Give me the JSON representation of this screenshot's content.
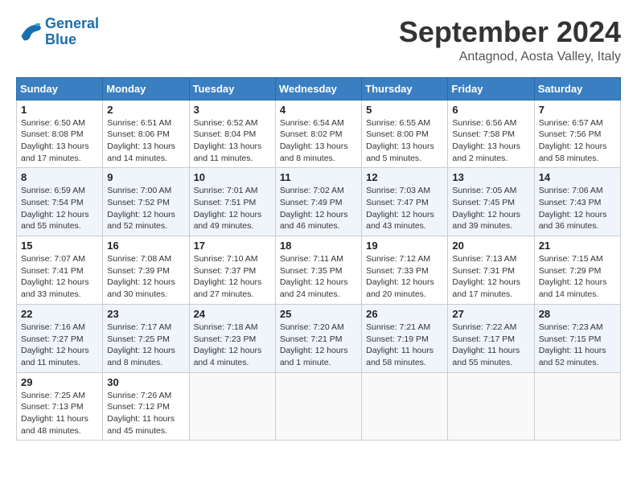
{
  "header": {
    "logo": {
      "line1": "General",
      "line2": "Blue"
    },
    "title": "September 2024",
    "location": "Antagnod, Aosta Valley, Italy"
  },
  "weekdays": [
    "Sunday",
    "Monday",
    "Tuesday",
    "Wednesday",
    "Thursday",
    "Friday",
    "Saturday"
  ],
  "weeks": [
    [
      {
        "day": "1",
        "sunrise": "6:50 AM",
        "sunset": "8:08 PM",
        "daylight": "13 hours and 17 minutes."
      },
      {
        "day": "2",
        "sunrise": "6:51 AM",
        "sunset": "8:06 PM",
        "daylight": "13 hours and 14 minutes."
      },
      {
        "day": "3",
        "sunrise": "6:52 AM",
        "sunset": "8:04 PM",
        "daylight": "13 hours and 11 minutes."
      },
      {
        "day": "4",
        "sunrise": "6:54 AM",
        "sunset": "8:02 PM",
        "daylight": "13 hours and 8 minutes."
      },
      {
        "day": "5",
        "sunrise": "6:55 AM",
        "sunset": "8:00 PM",
        "daylight": "13 hours and 5 minutes."
      },
      {
        "day": "6",
        "sunrise": "6:56 AM",
        "sunset": "7:58 PM",
        "daylight": "13 hours and 2 minutes."
      },
      {
        "day": "7",
        "sunrise": "6:57 AM",
        "sunset": "7:56 PM",
        "daylight": "12 hours and 58 minutes."
      }
    ],
    [
      {
        "day": "8",
        "sunrise": "6:59 AM",
        "sunset": "7:54 PM",
        "daylight": "12 hours and 55 minutes."
      },
      {
        "day": "9",
        "sunrise": "7:00 AM",
        "sunset": "7:52 PM",
        "daylight": "12 hours and 52 minutes."
      },
      {
        "day": "10",
        "sunrise": "7:01 AM",
        "sunset": "7:51 PM",
        "daylight": "12 hours and 49 minutes."
      },
      {
        "day": "11",
        "sunrise": "7:02 AM",
        "sunset": "7:49 PM",
        "daylight": "12 hours and 46 minutes."
      },
      {
        "day": "12",
        "sunrise": "7:03 AM",
        "sunset": "7:47 PM",
        "daylight": "12 hours and 43 minutes."
      },
      {
        "day": "13",
        "sunrise": "7:05 AM",
        "sunset": "7:45 PM",
        "daylight": "12 hours and 39 minutes."
      },
      {
        "day": "14",
        "sunrise": "7:06 AM",
        "sunset": "7:43 PM",
        "daylight": "12 hours and 36 minutes."
      }
    ],
    [
      {
        "day": "15",
        "sunrise": "7:07 AM",
        "sunset": "7:41 PM",
        "daylight": "12 hours and 33 minutes."
      },
      {
        "day": "16",
        "sunrise": "7:08 AM",
        "sunset": "7:39 PM",
        "daylight": "12 hours and 30 minutes."
      },
      {
        "day": "17",
        "sunrise": "7:10 AM",
        "sunset": "7:37 PM",
        "daylight": "12 hours and 27 minutes."
      },
      {
        "day": "18",
        "sunrise": "7:11 AM",
        "sunset": "7:35 PM",
        "daylight": "12 hours and 24 minutes."
      },
      {
        "day": "19",
        "sunrise": "7:12 AM",
        "sunset": "7:33 PM",
        "daylight": "12 hours and 20 minutes."
      },
      {
        "day": "20",
        "sunrise": "7:13 AM",
        "sunset": "7:31 PM",
        "daylight": "12 hours and 17 minutes."
      },
      {
        "day": "21",
        "sunrise": "7:15 AM",
        "sunset": "7:29 PM",
        "daylight": "12 hours and 14 minutes."
      }
    ],
    [
      {
        "day": "22",
        "sunrise": "7:16 AM",
        "sunset": "7:27 PM",
        "daylight": "12 hours and 11 minutes."
      },
      {
        "day": "23",
        "sunrise": "7:17 AM",
        "sunset": "7:25 PM",
        "daylight": "12 hours and 8 minutes."
      },
      {
        "day": "24",
        "sunrise": "7:18 AM",
        "sunset": "7:23 PM",
        "daylight": "12 hours and 4 minutes."
      },
      {
        "day": "25",
        "sunrise": "7:20 AM",
        "sunset": "7:21 PM",
        "daylight": "12 hours and 1 minute."
      },
      {
        "day": "26",
        "sunrise": "7:21 AM",
        "sunset": "7:19 PM",
        "daylight": "11 hours and 58 minutes."
      },
      {
        "day": "27",
        "sunrise": "7:22 AM",
        "sunset": "7:17 PM",
        "daylight": "11 hours and 55 minutes."
      },
      {
        "day": "28",
        "sunrise": "7:23 AM",
        "sunset": "7:15 PM",
        "daylight": "11 hours and 52 minutes."
      }
    ],
    [
      {
        "day": "29",
        "sunrise": "7:25 AM",
        "sunset": "7:13 PM",
        "daylight": "11 hours and 48 minutes."
      },
      {
        "day": "30",
        "sunrise": "7:26 AM",
        "sunset": "7:12 PM",
        "daylight": "11 hours and 45 minutes."
      },
      null,
      null,
      null,
      null,
      null
    ]
  ],
  "labels": {
    "sunrise": "Sunrise:",
    "sunset": "Sunset:",
    "daylight": "Daylight:"
  }
}
